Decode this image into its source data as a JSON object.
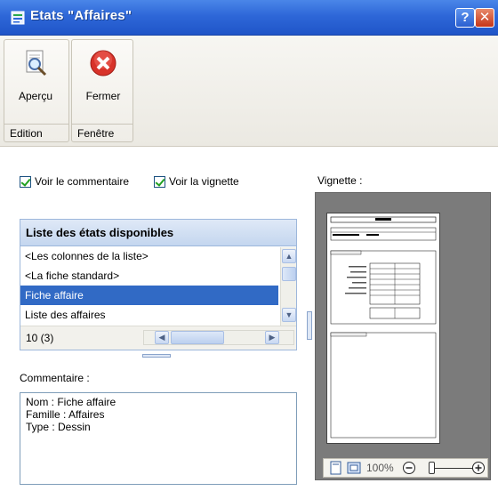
{
  "window": {
    "title": "Etats \"Affaires\"",
    "help_label": "?",
    "close_label": "✕"
  },
  "ribbon": {
    "groups": [
      {
        "label": "Edition",
        "buttons": [
          {
            "label": "Aperçu",
            "icon": "magnifier-document-icon"
          }
        ]
      },
      {
        "label": "Fenêtre",
        "buttons": [
          {
            "label": "Fermer",
            "icon": "close-red-circle-icon"
          }
        ]
      }
    ]
  },
  "options": {
    "show_comment": {
      "label": "Voir le commentaire",
      "checked": true
    },
    "show_thumbnail": {
      "label": "Voir la vignette",
      "checked": true
    }
  },
  "list": {
    "title": "Liste des états disponibles",
    "items": [
      "<Les colonnes de la liste>",
      "<La fiche standard>",
      "Fiche affaire",
      "Liste des affaires"
    ],
    "selected_index": 2,
    "count": "10 (3)"
  },
  "comment": {
    "label": "Commentaire :",
    "lines": [
      "Nom : Fiche affaire",
      "Famille : Affaires",
      "Type : Dessin"
    ]
  },
  "thumbnail": {
    "label": "Vignette :",
    "zoom": "100%"
  },
  "colors": {
    "titlebar": "#2e67d8",
    "selection": "#316ac5",
    "close_button": "#c5361a"
  }
}
